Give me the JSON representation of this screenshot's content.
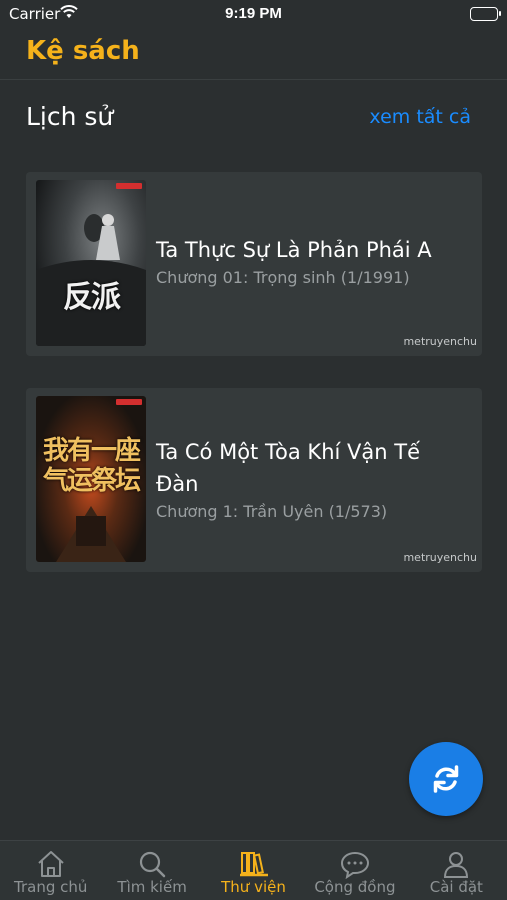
{
  "status_bar": {
    "carrier": "Carrier",
    "time": "9:19 PM"
  },
  "header": {
    "title": "Kệ sách"
  },
  "history": {
    "title": "Lịch sử",
    "see_all": "xem tất cả",
    "books": [
      {
        "title": "Ta Thực Sự Là Phản Phái A",
        "chapter": "Chương 01: Trọng sinh (1/1991)",
        "source": "metruyenchu",
        "cover_text": "反派"
      },
      {
        "title": "Ta Có Một Tòa Khí Vận Tế Đàn",
        "chapter": "Chương 1: Trần Uyên (1/573)",
        "source": "metruyenchu",
        "cover_text": "我有一座气运祭坛"
      }
    ]
  },
  "tabs": [
    {
      "label": "Trang chủ",
      "icon": "home-icon",
      "active": false
    },
    {
      "label": "Tìm kiếm",
      "icon": "search-icon",
      "active": false
    },
    {
      "label": "Thư viện",
      "icon": "bookshelf-icon",
      "active": true
    },
    {
      "label": "Cộng đồng",
      "icon": "chat-bubble-icon",
      "active": false
    },
    {
      "label": "Cài đặt",
      "icon": "user-icon",
      "active": false
    }
  ],
  "colors": {
    "accent": "#f5b21b",
    "link": "#1a8cff",
    "background": "#2b2f30",
    "card": "#353a3b",
    "fab": "#1a7ee6"
  },
  "fab": {
    "icon": "sync-icon"
  }
}
